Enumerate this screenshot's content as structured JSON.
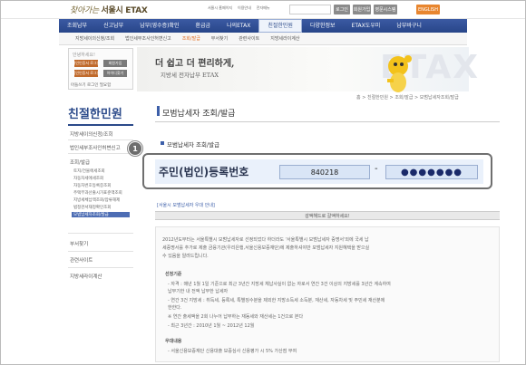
{
  "header": {
    "logo_script": "찾아가는",
    "logo_text": "서울시 ETAX",
    "links": [
      "서울시 홈페이지",
      "이용안내",
      "전자메뉴"
    ],
    "buttons": [
      "로그인",
      "회원가입",
      "영문시스템",
      "ENGLISH"
    ]
  },
  "nav": {
    "items": [
      "조회납부",
      "신고납부",
      "납부(영수증)확인",
      "환급금",
      "나의ETAX",
      "친절한민원",
      "다양한정보",
      "ETAX도우미",
      "납부바구니"
    ],
    "active_index": 5
  },
  "subnav": {
    "items": [
      "지방세이의신청/조회",
      "법인세부조사인허변신고",
      "조회/발급",
      "부서찾기",
      "관련사이트",
      "지방세라이계산"
    ],
    "active_index": 2
  },
  "login": {
    "title": "안녕하세요!",
    "buttons": [
      "개인인증서 로그인",
      "회원가입",
      "법인인증서 로그인",
      "아이디찾기"
    ],
    "bottom": "아들쓰기 로그인 필요함"
  },
  "banner": {
    "line1": "더 쉽고 더 편리하게,",
    "line2": "지방세 전자납부 ETAX",
    "watermark": "ETAX"
  },
  "left_menu": {
    "title": "친절한민원",
    "items": [
      "지방세이의신청/조회",
      "법인세부조사인허변신고",
      "조회/발급"
    ],
    "sub_items": [
      "토지/건물에세조회",
      "자동차세에세조회",
      "자동차번호등록증조회",
      "주택부과산출시가표준액조회",
      "지방세체납액조회/압류해제",
      "법정관서재정확인조회",
      "모범납세자조회/발급"
    ],
    "sub_active_index": 6,
    "lower_items": [
      "부서찾기",
      "관련사이트",
      "지방세라이계산"
    ]
  },
  "main": {
    "title": "모범납세자 조회/발급",
    "breadcrumb": "홈 > 친절한민원 > 조회/발급 > 모범납세자조회/발급",
    "section_title": "모범납세자 조회/발급",
    "badge_number": "1",
    "ssn_label": "주민(법인)등록번호",
    "ssn_front": "840218",
    "ssn_separator": "-",
    "ssn_back": "●●●●●●●",
    "small_link": "[서울시 모범납세자 우대 안내]",
    "notice_bar": "감액해드로 갈액하세요!",
    "notice_lines": [
      "2012년도부터는 서울특별시 모범납세자로 선정되었다 하더라도 '서울특별시 모범납세자 증명서'외에 국세 납",
      "세증명서를 추가로 제출 금융기관(우리은행,서울신용보증재단)에 제출하셔야만 모범납세자 지원혜택을 받으실",
      "수 있음을 알려드립니다."
    ],
    "criteria_head": "선정기준",
    "criteria_lines": [
      "- 자격 : 매년 1월 1일 기준으로 최근 3년간 지방세 체납사실이 없는 자로서 연간 3건 이상의 지방세를 3년간 계속하여",
      "  납부기한 내 전액 납부한 납세자",
      "- 연간 3건 지방세 : 취득세, 등록세, 특별징수분을 제외한 지방소득세 소득분, 재산세, 자동차세 및 주민세 재산분에",
      "  한한다.",
      "※ 연간 출세액을 2회 나누어 납부하는 재동세와 재산세는 1건으로 본다",
      "- 최근 3년간 : 2010년 1월 ~ 2012년 12월"
    ],
    "benefit_head": "우대내용",
    "benefit_lines": [
      "- 서울신용보증재단 신용대출 보증심사 신용평가 시 5% 가산점 부여"
    ]
  },
  "colors": {
    "nav_bg": "#284689",
    "accent_orange": "#e06a1a",
    "field_bg": "#d9e5f6",
    "highlight_border": "#6f6f6f"
  }
}
